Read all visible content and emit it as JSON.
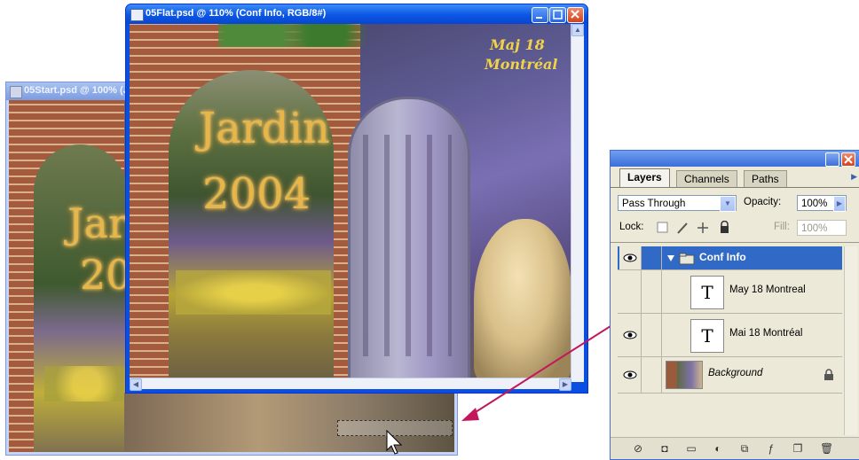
{
  "back_window": {
    "title": "05Start.psd @ 100% (J",
    "canvas": {
      "line1": "Jar",
      "line2": "20"
    }
  },
  "front_window": {
    "title": "05Flat.psd @ 110% (Conf Info, RGB/8#)",
    "canvas": {
      "main_title_1": "Jardin",
      "main_title_2": "2004",
      "date_line_1": "Maj 18",
      "date_line_2": "Montréal"
    }
  },
  "layers_panel": {
    "tabs": [
      {
        "label": "Layers",
        "active": true
      },
      {
        "label": "Channels",
        "active": false
      },
      {
        "label": "Paths",
        "active": false
      }
    ],
    "blend_mode": "Pass Through",
    "opacity_label": "Opacity:",
    "opacity_value": "100%",
    "lock_label": "Lock:",
    "fill_label": "Fill:",
    "fill_value": "100%",
    "layers": [
      {
        "name": "Conf Info",
        "type": "group",
        "selected": true,
        "visible": true
      },
      {
        "name": "May 18 Montreal",
        "type": "text",
        "visible": false
      },
      {
        "name": "Mai 18 Montréal",
        "type": "text",
        "visible": true
      },
      {
        "name": "Background",
        "type": "image",
        "locked": true,
        "visible": true
      }
    ],
    "bottom_icons": [
      "link-layers-icon",
      "layer-style-icon",
      "new-group-icon",
      "adjustment-layer-icon",
      "new-layer-icon",
      "trash-icon"
    ]
  },
  "colors": {
    "title_accent": "#e8b648",
    "selection": "#3169c6",
    "drag_arrow": "#c2185b"
  }
}
